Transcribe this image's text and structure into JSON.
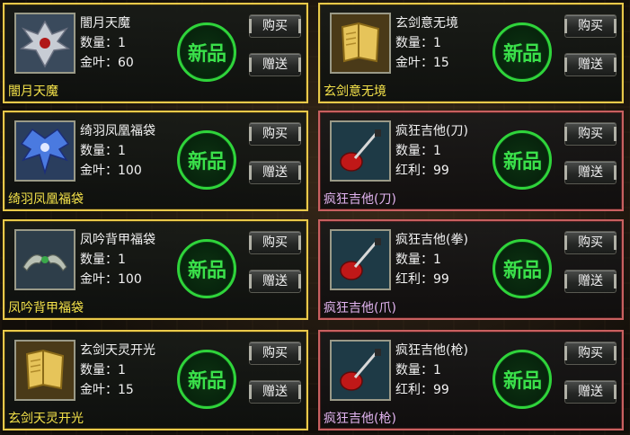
{
  "labels": {
    "qty": "数量：",
    "gold": "金叶：",
    "bonus": "红利：",
    "badge": "新品",
    "buy": "购买",
    "gift": "赠送"
  },
  "colors": {
    "frame_gold": "#e9c94a",
    "frame_red": "#c86060",
    "badge_green": "#2fd43b",
    "caption_yellow": "#f4e24a",
    "caption_pink": "#e2b4f0"
  },
  "items": [
    {
      "name": "闇月天魔",
      "qty": "1",
      "price": "60",
      "currency": "gold",
      "caption": "闇月天魔",
      "icon": "dark-moon-demon-icon",
      "frame": "gold"
    },
    {
      "name": "玄剑意无境",
      "qty": "1",
      "price": "15",
      "currency": "gold",
      "caption": "玄剑意无境",
      "icon": "skill-book-icon",
      "frame": "gold"
    },
    {
      "name": "绮羽凤凰福袋",
      "qty": "1",
      "price": "100",
      "currency": "gold",
      "caption": "绮羽凤凰福袋",
      "icon": "phoenix-wings-icon",
      "frame": "gold"
    },
    {
      "name": "疯狂吉他(刀)",
      "qty": "1",
      "price": "99",
      "currency": "bonus",
      "caption": "疯狂吉他(刀)",
      "icon": "guitar-icon",
      "frame": "red"
    },
    {
      "name": "凤吟背甲福袋",
      "qty": "1",
      "price": "100",
      "currency": "gold",
      "caption": "凤吟背甲福袋",
      "icon": "back-armor-icon",
      "frame": "gold"
    },
    {
      "name": "疯狂吉他(拳)",
      "qty": "1",
      "price": "99",
      "currency": "bonus",
      "caption": "疯狂吉他(爪)",
      "icon": "guitar-icon",
      "frame": "red"
    },
    {
      "name": "玄剑天灵开光",
      "qty": "1",
      "price": "15",
      "currency": "gold",
      "caption": "玄剑天灵开光",
      "icon": "skill-book-icon",
      "frame": "gold"
    },
    {
      "name": "疯狂吉他(枪)",
      "qty": "1",
      "price": "99",
      "currency": "bonus",
      "caption": "疯狂吉他(枪)",
      "icon": "guitar-icon",
      "frame": "red"
    }
  ]
}
